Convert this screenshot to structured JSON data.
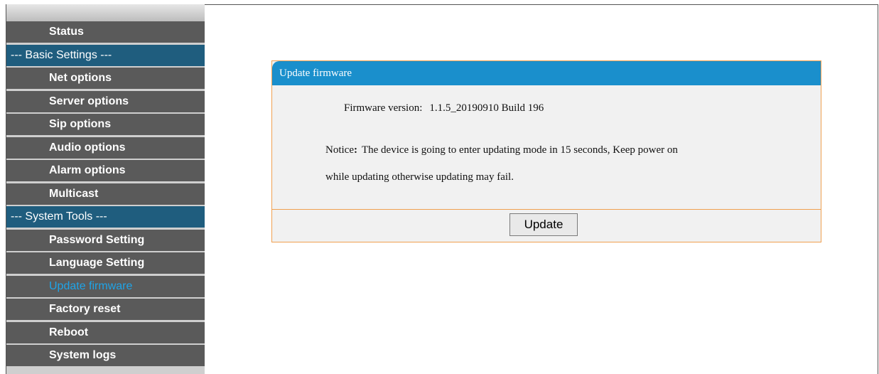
{
  "sidebar": {
    "items": [
      {
        "type": "item",
        "label": "Status"
      },
      {
        "type": "header",
        "label": "--- Basic Settings ---"
      },
      {
        "type": "item",
        "label": "Net options"
      },
      {
        "type": "item",
        "label": "Server options"
      },
      {
        "type": "item",
        "label": "Sip options"
      },
      {
        "type": "item",
        "label": "Audio options"
      },
      {
        "type": "item",
        "label": "Alarm options"
      },
      {
        "type": "item",
        "label": "Multicast"
      },
      {
        "type": "header",
        "label": "--- System Tools ---"
      },
      {
        "type": "item",
        "label": "Password Setting"
      },
      {
        "type": "item",
        "label": "Language Setting"
      },
      {
        "type": "item",
        "label": "Update firmware",
        "active": true
      },
      {
        "type": "item",
        "label": "Factory reset"
      },
      {
        "type": "item",
        "label": "Reboot"
      },
      {
        "type": "item",
        "label": "System logs"
      }
    ]
  },
  "panel": {
    "title": "Update firmware",
    "firmware_label": "Firmware version:",
    "firmware_value": "1.1.5_20190910 Build 196",
    "notice_label": "Notice",
    "notice_colon": ":",
    "notice_line1": "The device is going to enter updating mode in 15 seconds, Keep power on",
    "notice_line2": "while updating otherwise updating may fail.",
    "update_button": "Update"
  },
  "colors": {
    "sidebar_item_bg": "#5a5a5a",
    "sidebar_header_bg": "#1f5d7e",
    "active_item_text": "#1fa4e8",
    "panel_header_bg": "#1a8fcc",
    "panel_border": "#f0a050"
  }
}
